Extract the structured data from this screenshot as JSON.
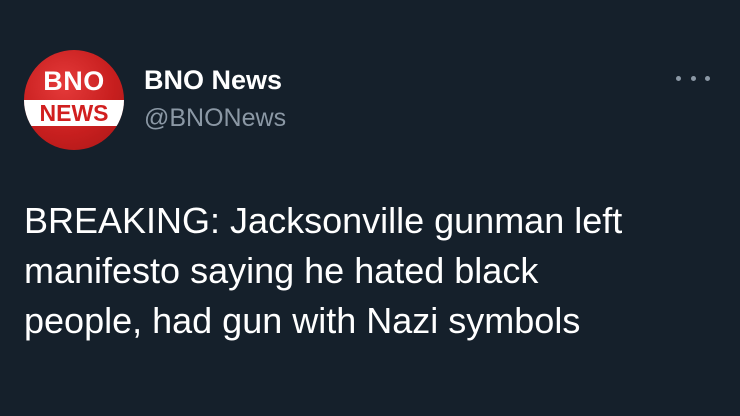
{
  "account": {
    "display_name": "BNO News",
    "handle": "@BNONews",
    "avatar": {
      "logo_top": "BNO",
      "logo_bottom": "NEWS",
      "brand_color": "#d11f1f"
    }
  },
  "menu": {
    "icon": "more-horizontal-icon"
  },
  "tweet": {
    "text_lines": [
      "BREAKING: Jacksonville gunman left",
      "manifesto saying he hated black",
      "people, had gun with Nazi symbols"
    ]
  },
  "colors": {
    "background": "#15202b",
    "primary_text": "#ffffff",
    "secondary_text": "#8b98a5"
  }
}
